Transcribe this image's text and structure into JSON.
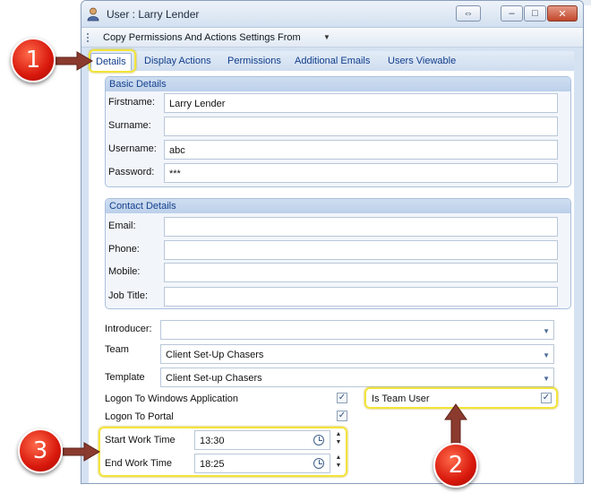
{
  "window": {
    "title": "User : Larry Lender",
    "controls": {
      "swap": "⇔",
      "minimize": "–",
      "maximize": "□",
      "close": "✕"
    }
  },
  "menu": {
    "copy_permissions": "Copy Permissions And Actions Settings From"
  },
  "tabs": [
    {
      "label": "Details",
      "active": true
    },
    {
      "label": "Display Actions"
    },
    {
      "label": "Permissions"
    },
    {
      "label": "Additional Emails"
    },
    {
      "label": "Users Viewable"
    }
  ],
  "basic_details": {
    "title": "Basic Details",
    "firstname": {
      "label": "Firstname:",
      "value": "Larry Lender"
    },
    "surname": {
      "label": "Surname:",
      "value": ""
    },
    "username": {
      "label": "Username:",
      "value": "abc"
    },
    "password": {
      "label": "Password:",
      "value": "***"
    }
  },
  "contact_details": {
    "title": "Contact Details",
    "email": {
      "label": "Email:",
      "value": ""
    },
    "phone": {
      "label": "Phone:",
      "value": ""
    },
    "mobile": {
      "label": "Mobile:",
      "value": ""
    },
    "job_title": {
      "label": "Job Title:",
      "value": ""
    }
  },
  "other": {
    "introducer": {
      "label": "Introducer:",
      "value": ""
    },
    "team": {
      "label": "Team",
      "value": "Client Set-Up Chasers"
    },
    "template": {
      "label": "Template",
      "value": "Client Set-up Chasers"
    },
    "logon_windows": {
      "label": "Logon To Windows Application",
      "checked": true
    },
    "logon_portal": {
      "label": "Logon To Portal",
      "checked": true
    },
    "is_team_user": {
      "label": "Is Team User",
      "checked": true
    },
    "start_work_time": {
      "label": "Start Work Time",
      "value": "13:30"
    },
    "end_work_time": {
      "label": "End Work Time",
      "value": "18:25"
    }
  },
  "annotations": {
    "badge1": "1",
    "badge2": "2",
    "badge3": "3",
    "badge_color": "#d8180c",
    "highlight_color": "#f3e43a",
    "arrow_color": "#8b3a2e"
  },
  "icons": {
    "window": "user-icon",
    "checkbox_mark": "✓",
    "combo": "▼",
    "spin_up": "▲",
    "spin_down": "▼"
  }
}
